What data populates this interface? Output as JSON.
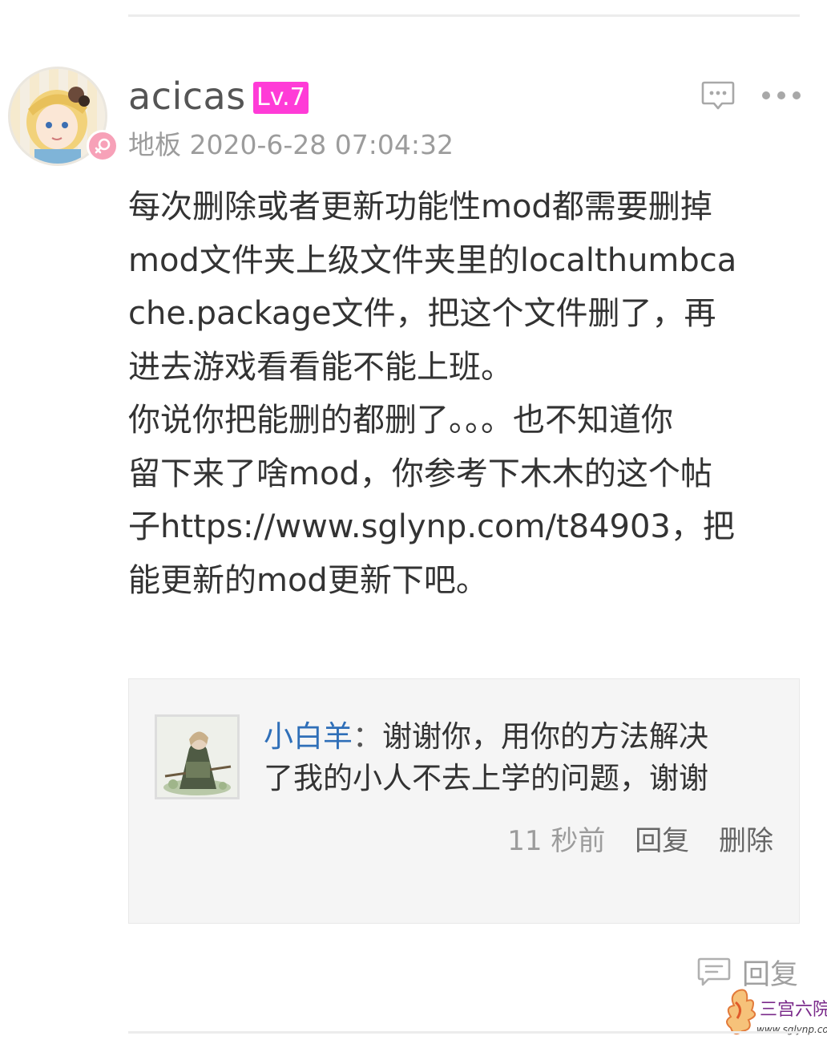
{
  "post": {
    "username": "acicas",
    "level": "Lv.7",
    "floor": "地板",
    "timestamp": "2020-6-28 07:04:32",
    "body_lines": [
      "每次删除或者更新功能性mod都需要删掉",
      "mod文件夹上级文件夹里的localthumbca",
      "che.package文件，把这个文件删了，再",
      "进去游戏看看能不能上班。",
      "你说你把能删的都删了。。。也不知道你",
      "留下来了啥mod，你参考下木木的这个帖",
      "子https://www.sglynp.com/t84903，把",
      "能更新的mod更新下吧。"
    ]
  },
  "reply": {
    "username": "小白羊",
    "separator": "：",
    "text_line1": "谢谢你，用你的方法解决",
    "text_line2": "了我的小人不去上学的问题，谢谢",
    "time": "11 秒前",
    "reply_action": "回复",
    "delete_action": "删除"
  },
  "actions": {
    "reply_label": "回复"
  },
  "watermark": {
    "name": "三宫六院",
    "url": "www.sglynp.com"
  },
  "colors": {
    "level_badge": "#ff3bd7",
    "gender_badge": "#f7a1b8",
    "reply_username": "#2f6fb8",
    "meta_gray": "#9c9c9c"
  }
}
